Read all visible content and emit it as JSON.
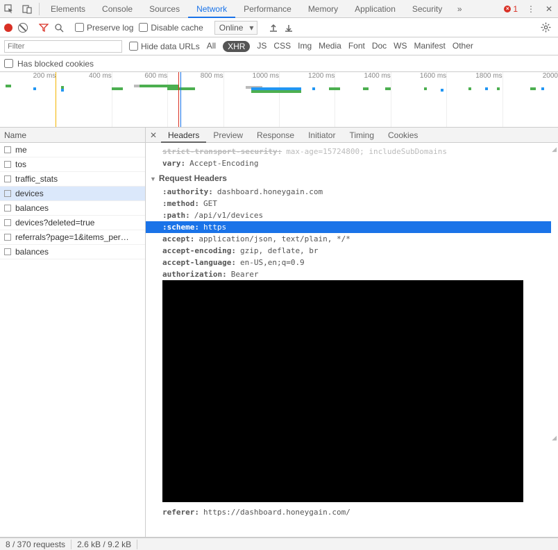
{
  "tabs": [
    "Elements",
    "Console",
    "Sources",
    "Network",
    "Performance",
    "Memory",
    "Application",
    "Security"
  ],
  "active_tab": "Network",
  "error_count": "1",
  "toolbar": {
    "preserve_log": "Preserve log",
    "disable_cache": "Disable cache",
    "throttle": "Online"
  },
  "filter": {
    "placeholder": "Filter",
    "hide_data_urls": "Hide data URLs",
    "types": [
      "All",
      "XHR",
      "JS",
      "CSS",
      "Img",
      "Media",
      "Font",
      "Doc",
      "WS",
      "Manifest",
      "Other"
    ],
    "active_type": "XHR"
  },
  "blocked_cookies": "Has blocked cookies",
  "timeline_ticks": [
    "200 ms",
    "400 ms",
    "600 ms",
    "800 ms",
    "1000 ms",
    "1200 ms",
    "1400 ms",
    "1600 ms",
    "1800 ms",
    "2000"
  ],
  "name_header": "Name",
  "requests": [
    "me",
    "tos",
    "traffic_stats",
    "devices",
    "balances",
    "devices?deleted=true",
    "referrals?page=1&items_per…",
    "balances"
  ],
  "selected_request_index": 3,
  "detail_tabs": [
    "Headers",
    "Preview",
    "Response",
    "Initiator",
    "Timing",
    "Cookies"
  ],
  "active_detail_tab": "Headers",
  "truncated_row": {
    "k": "strict-transport-security:",
    "v": "max-age=15724800; includeSubDomains"
  },
  "prev_rows": [
    {
      "k": "vary:",
      "v": "Accept-Encoding"
    }
  ],
  "section_title": "Request Headers",
  "headers": [
    {
      "k": ":authority:",
      "v": "dashboard.honeygain.com"
    },
    {
      "k": ":method:",
      "v": "GET"
    },
    {
      "k": ":path:",
      "v": "/api/v1/devices"
    },
    {
      "k": ":scheme:",
      "v": "https",
      "highlight": true
    },
    {
      "k": "accept:",
      "v": "application/json, text/plain, */*"
    },
    {
      "k": "accept-encoding:",
      "v": "gzip, deflate, br"
    },
    {
      "k": "accept-language:",
      "v": "en-US,en;q=0.9"
    },
    {
      "k": "authorization:",
      "v": "Bearer "
    }
  ],
  "post_redact_rows": [
    {
      "k": "referer:",
      "v": "https://dashboard.honeygain.com/"
    }
  ],
  "status": {
    "requests": "8 / 370 requests",
    "transfer": "2.6 kB / 9.2 kB"
  }
}
